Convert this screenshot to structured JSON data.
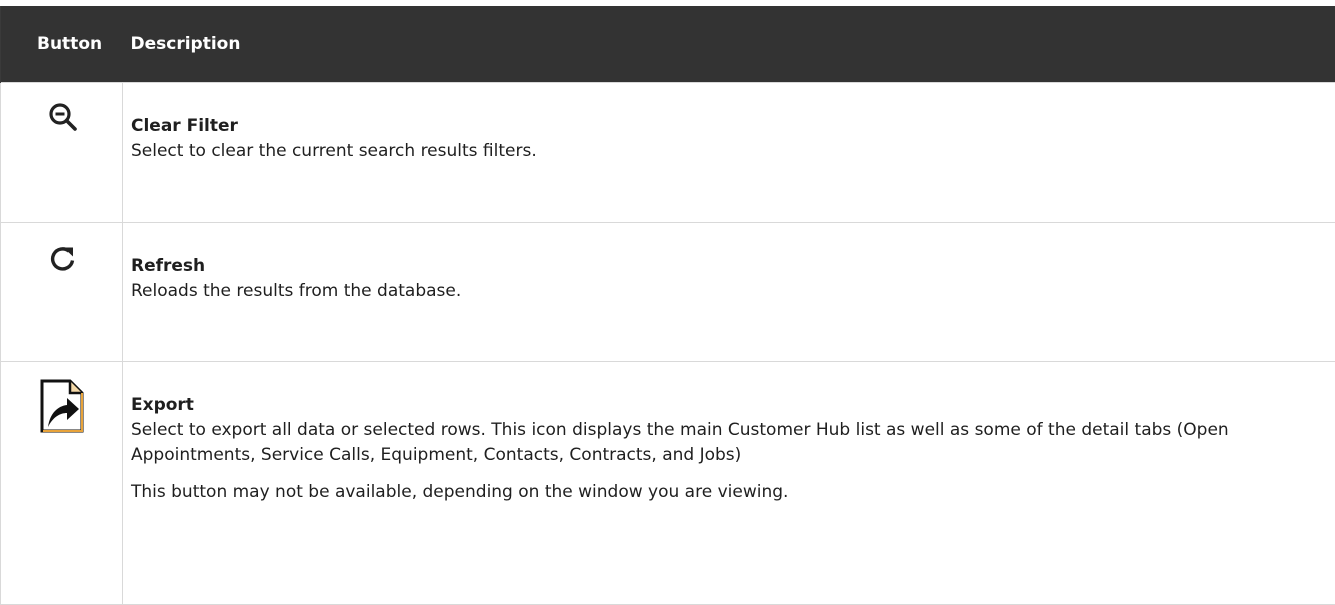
{
  "table": {
    "headers": {
      "button": "Button",
      "description": "Description"
    },
    "rows": [
      {
        "icon": "zoom-out-icon",
        "title": "Clear Filter",
        "description": "Select to clear the current search results filters."
      },
      {
        "icon": "refresh-icon",
        "title": "Refresh",
        "description": "Reloads the results from the database."
      },
      {
        "icon": "export-icon",
        "title": "Export",
        "description": "Select to export all data or selected rows. This icon displays the main Customer Hub list as well as some of the detail tabs (Open Appointments, Service Calls, Equipment, Contacts, Contracts, and Jobs)",
        "note": "This button may not be available, depending on the window you are viewing."
      }
    ]
  },
  "colors": {
    "header_background": "#333333",
    "header_text": "#ffffff",
    "icon_color": "#222222",
    "export_icon_accent": "#e8a33a"
  }
}
